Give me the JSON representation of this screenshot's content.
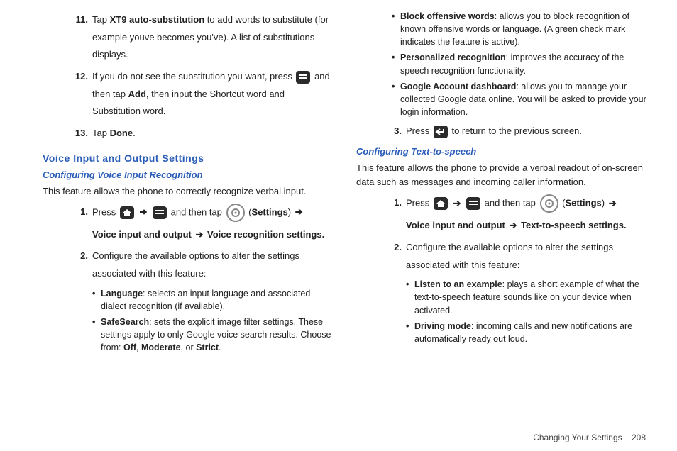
{
  "left": {
    "items": [
      {
        "num": "11.",
        "pre": "Tap ",
        "bold1": "XT9 auto-substitution",
        "post": " to add words to substitute (for example youve becomes you've). A list of substitutions displays."
      },
      {
        "num": "12.",
        "pre": "If you do not see the substitution you want, press ",
        "mid": " and then tap ",
        "bold1": "Add",
        "post": ", then input the Shortcut word and Substitution word."
      },
      {
        "num": "13.",
        "pre": "Tap ",
        "bold1": "Done",
        "post": "."
      }
    ],
    "heading_blue": "Voice Input and Output Settings",
    "subheading": "Configuring Voice Input Recognition",
    "intro": "This feature allows the phone to correctly recognize verbal input.",
    "step1_pre": "Press ",
    "step1_mid": " and then tap ",
    "step1_settings": "Settings",
    "step1_path_a": "Voice input and output",
    "step1_path_b": "Voice recognition settings",
    "step2": "Configure the available options to alter the settings associated with this feature:",
    "bullets": [
      {
        "title": "Language",
        "text": ": selects an input language and associated dialect recognition (if available)."
      },
      {
        "title": "SafeSearch",
        "text": ": sets the explicit image filter settings. These settings apply to only Google voice search results. Choose from: ",
        "opt1": "Off",
        "opt2": "Moderate",
        "opt3": "Strict",
        "or": ", or "
      }
    ]
  },
  "right": {
    "bullets_top": [
      {
        "title": "Block offensive words",
        "text": ": allows you to block recognition of known offensive words or language. (A green check mark indicates the feature is active)."
      },
      {
        "title": "Personalized recognition",
        "text": ": improves the accuracy of the speech recognition functionality."
      },
      {
        "title": "Google Account dashboard",
        "text": ": allows you to manage your collected Google data online. You will be asked to provide your login information."
      }
    ],
    "step3_pre": "Press ",
    "step3_post": " to return to the previous screen.",
    "subheading": "Configuring Text-to-speech",
    "intro": "This feature allows the phone to provide a verbal readout of on-screen data such as messages and incoming caller information.",
    "step1_pre": "Press ",
    "step1_mid": " and then tap ",
    "step1_settings": "Settings",
    "step1_path_a": "Voice input and output",
    "step1_path_b": "Text-to-speech settings",
    "step2": "Configure the available options to alter the settings associated with this feature:",
    "bullets_bottom": [
      {
        "title": "Listen to an example",
        "text": ": plays a short example of what the text-to-speech feature sounds like on your device when activated."
      },
      {
        "title": "Driving mode",
        "text": ": incoming calls and new notifications are automatically ready out loud."
      }
    ]
  },
  "footer_section": "Changing Your Settings",
  "footer_page": "208"
}
